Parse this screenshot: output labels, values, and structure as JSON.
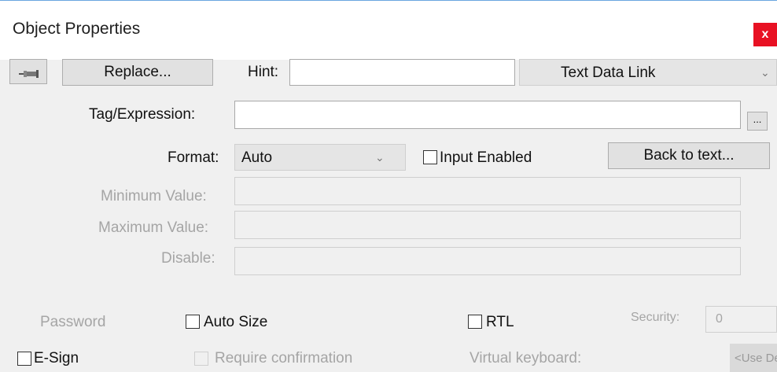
{
  "window": {
    "title": "Object Properties",
    "close_label": "x"
  },
  "toolbar": {
    "replace_label": "Replace...",
    "hint_label": "Hint:",
    "hint_value": "",
    "link_type": "Text Data Link"
  },
  "tag": {
    "label": "Tag/Expression:",
    "value": "",
    "browse_label": "..."
  },
  "format": {
    "label": "Format:",
    "value": "Auto",
    "input_enabled_label": "Input Enabled",
    "back_to_text_label": "Back to text..."
  },
  "minimum": {
    "label": "Minimum Value:",
    "value": ""
  },
  "maximum": {
    "label": "Maximum Value:",
    "value": ""
  },
  "disable": {
    "label": "Disable:",
    "value": ""
  },
  "options": {
    "password_label": "Password",
    "auto_size_label": "Auto Size",
    "rtl_label": "RTL",
    "security_label": "Security:",
    "security_value": "0",
    "esign_label": "E-Sign",
    "require_confirmation_label": "Require confirmation",
    "virtual_keyboard_label": "Virtual keyboard:",
    "virtual_keyboard_value": "<Use Default>"
  }
}
